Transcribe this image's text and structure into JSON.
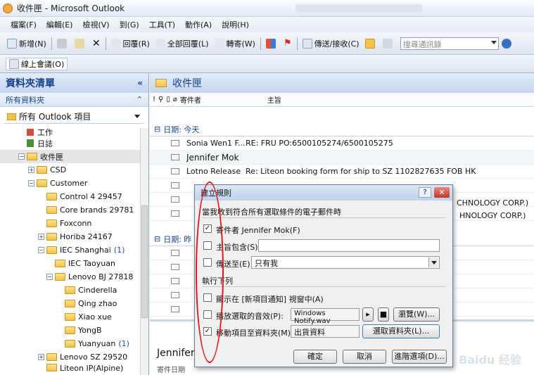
{
  "window": {
    "title": "收件匣 - Microsoft Outlook"
  },
  "menu": [
    "檔案(F)",
    "編輯(E)",
    "檢視(V)",
    "到(G)",
    "工具(T)",
    "動作(A)",
    "說明(H)"
  ],
  "toolbar": {
    "new": "新增(N)",
    "reply": "回覆(R)",
    "reply_all": "全部回覆(L)",
    "forward": "轉寄(W)",
    "send_receive": "傳送/接收(C)",
    "search_placeholder": "搜尋通訊錄"
  },
  "toolbar2": {
    "online_meeting": "線上會議(O)"
  },
  "nav": {
    "title": "資料夾清單",
    "subtitle": "所有資料夾",
    "select": "所有 Outlook 項目",
    "items": [
      {
        "label": "工作",
        "count": ""
      },
      {
        "label": "日誌",
        "count": ""
      },
      {
        "label": "收件匣",
        "count": ""
      },
      {
        "label": "CSD",
        "count": ""
      },
      {
        "label": "Customer",
        "count": ""
      },
      {
        "label": "Control 4 29457",
        "count": ""
      },
      {
        "label": "Core brands 29781",
        "count": ""
      },
      {
        "label": "Foxconn",
        "count": ""
      },
      {
        "label": "Horiba 24167",
        "count": ""
      },
      {
        "label": "IEC Shanghai",
        "count": "(1)"
      },
      {
        "label": "IEC Taoyuan",
        "count": ""
      },
      {
        "label": "Lenovo BJ 27818",
        "count": ""
      },
      {
        "label": "Cinderella",
        "count": ""
      },
      {
        "label": "Qing zhao",
        "count": ""
      },
      {
        "label": "Xiao xue",
        "count": ""
      },
      {
        "label": "YongB",
        "count": ""
      },
      {
        "label": "Yuanyuan",
        "count": "(1)"
      },
      {
        "label": "Lenovo SZ 29520",
        "count": ""
      },
      {
        "label": "Liteon IP(Alpine)",
        "count": ""
      }
    ]
  },
  "mail": {
    "folder_title": "收件匣",
    "col_from": "寄件者",
    "col_subject": "主旨",
    "group_today": "日期: 今天",
    "group_other": "日期: 昨",
    "rows": [
      {
        "from": "Sonia Wen1 F...",
        "subject": "RE: FRU PO:6500105274/6500105275"
      },
      {
        "from": "Jennifer Mok",
        "subject": ""
      },
      {
        "from": "Lotno Release",
        "subject": "Re: Liteon booking form for ship to SZ 1102827635 FOB HK"
      }
    ],
    "frag1": "CHNOLOGY CORP.)",
    "frag2": "HNOLOGY CORP.)",
    "preview_name": "Jennifer",
    "preview_sent": "寄件日期"
  },
  "dialog": {
    "title": "建立規則",
    "section1": "當我收到符合所有選取條件的電子郵件時",
    "cond_from": "寄件者 Jennifer Mok(F)",
    "cond_subject": "主旨包含(S)",
    "cond_sent_to": "傳送至(E)",
    "sent_to_value": "只有我",
    "section2": "執行下列",
    "act_alert": "顯示在 [新項目通知] 視窗中(A)",
    "act_sound": "播放選取的音效(P):",
    "sound_value": "Windows Notify.wav",
    "browse": "瀏覽(W)...",
    "act_move": "移動項目至資料夾(M):",
    "move_value": "出貨資料",
    "select_folder": "選取資料夾(L)...",
    "ok": "確定",
    "cancel": "取消",
    "advanced": "進階選項(D)..."
  },
  "watermark": "Baidu 经验"
}
